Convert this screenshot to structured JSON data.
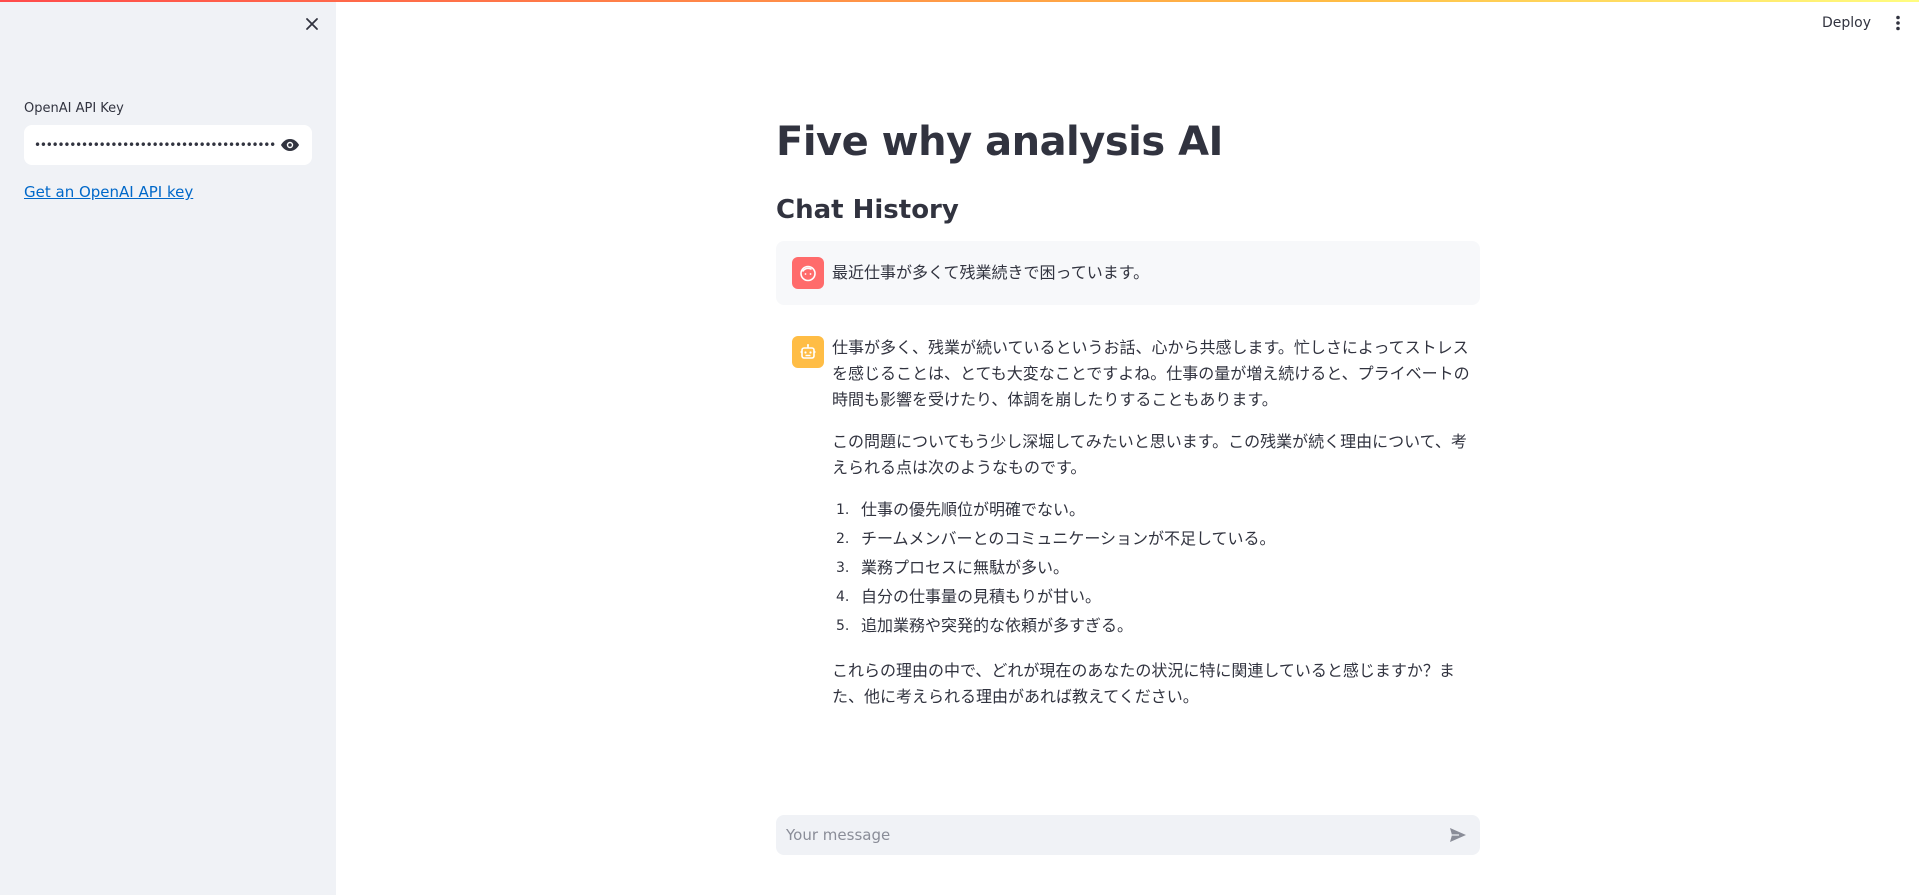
{
  "sidebar": {
    "api_key_label": "OpenAI API Key",
    "api_key_value": "••••••••••••••••••••••••••••••••••••••••••••••••••••",
    "link_text": "Get an OpenAI API key"
  },
  "header": {
    "deploy_label": "Deploy"
  },
  "main": {
    "title": "Five why analysis AI",
    "section_title": "Chat History",
    "messages": [
      {
        "role": "user",
        "text": "最近仕事が多くて残業続きで困っています。"
      },
      {
        "role": "assistant",
        "intro_lines": [
          "仕事が多く、残業が続いているというお話、心から共感します。忙しさによってストレス",
          "を感じることは、とても大変なことですよね。仕事の量が増え続けると、プライベートの",
          "時間も影響を受けたり、体調を崩したりすることもあります。"
        ],
        "second_lines": [
          "この問題についてもう少し深堀してみたいと思います。この残業が続く理由について、考",
          "えられる点は次のようなものです。"
        ],
        "list": [
          {
            "num": "1.",
            "text": "仕事の優先順位が明確でない。"
          },
          {
            "num": "2.",
            "text": "チームメンバーとのコミュニケーションが不足している。"
          },
          {
            "num": "3.",
            "text": "業務プロセスに無駄が多い。"
          },
          {
            "num": "4.",
            "text": "自分の仕事量の見積もりが甘い。"
          },
          {
            "num": "5.",
            "text": "追加業務や突発的な依頼が多すぎる。"
          }
        ],
        "closing_lines": [
          "これらの理由の中で、どれが現在のあなたの状況に特に関連していると感じますか？ま",
          "た、他に考えられる理由があれば教えてください。"
        ]
      }
    ]
  },
  "chat_input": {
    "placeholder": "Your message"
  },
  "icons": {
    "sidebar_close": "close-icon",
    "password_toggle": "eye-icon",
    "header_menu": "vertical-dots-icon",
    "user_avatar": "user-face-icon",
    "bot_avatar": "robot-icon",
    "send": "send-icon"
  },
  "colors": {
    "accent": "#ff4b4b",
    "link": "#0068c9",
    "user_avatar": "#ff6b6b",
    "bot_avatar": "#ffbd45",
    "sidebar_bg": "#f0f2f6"
  }
}
